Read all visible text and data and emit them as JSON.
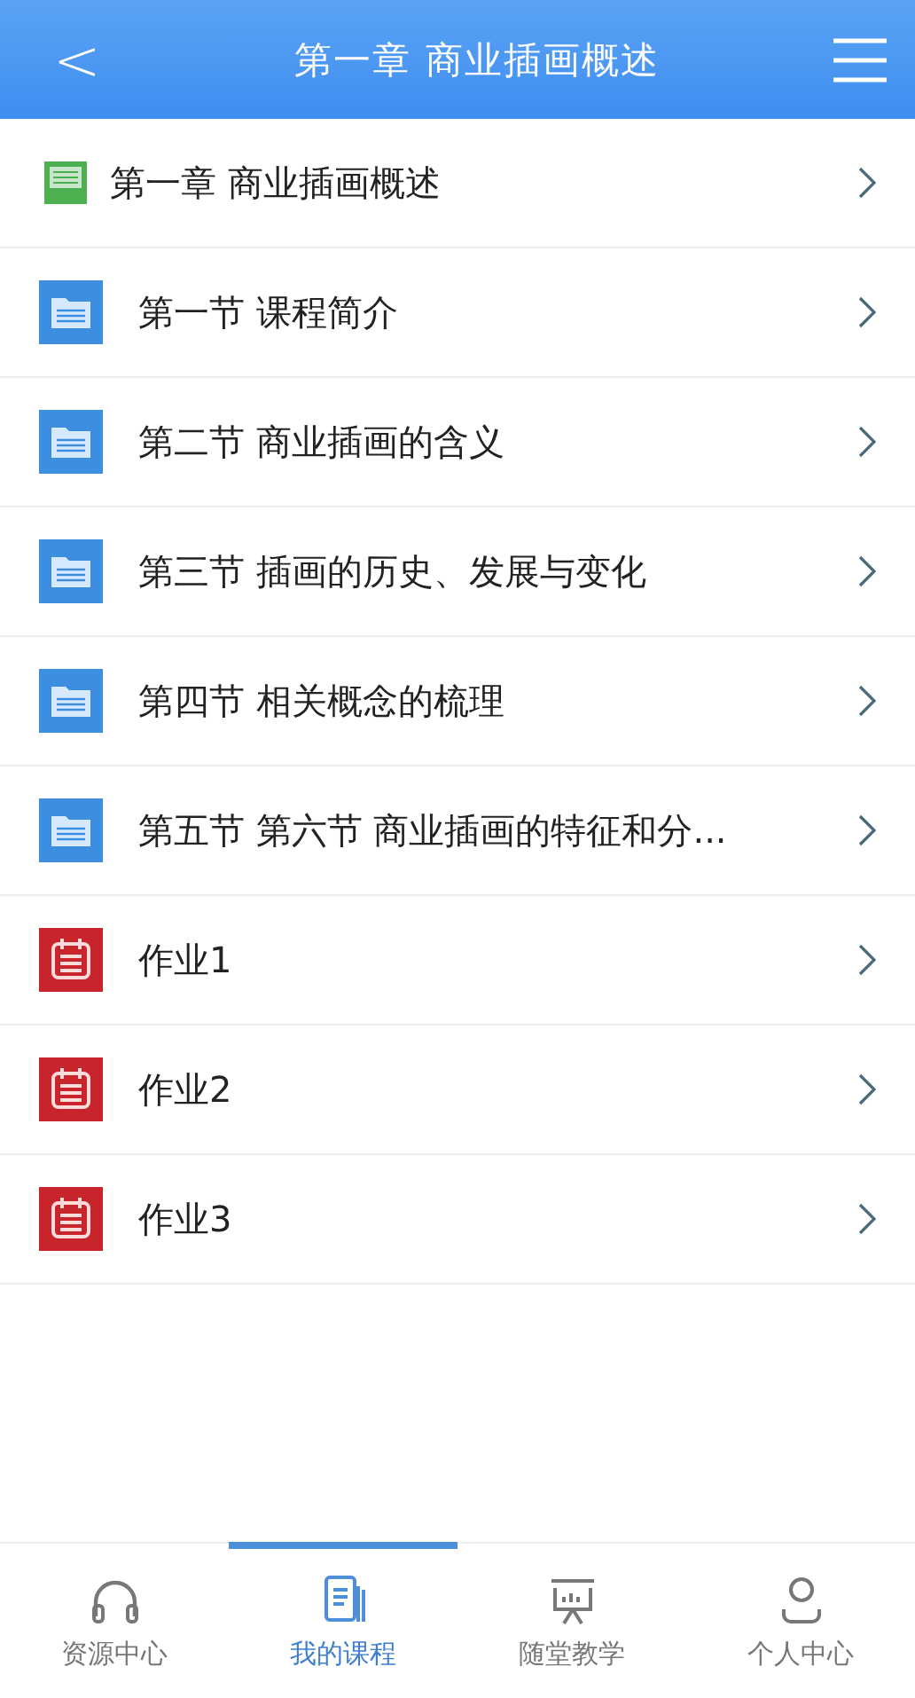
{
  "header": {
    "title": "第一章 商业插画概述",
    "back": "<"
  },
  "items": [
    {
      "kind": "chapter",
      "label": "第一章 商业插画概述"
    },
    {
      "kind": "section",
      "label": "第一节 课程简介"
    },
    {
      "kind": "section",
      "label": "第二节 商业插画的含义"
    },
    {
      "kind": "section",
      "label": "第三节 插画的历史、发展与变化"
    },
    {
      "kind": "section",
      "label": "第四节 相关概念的梳理"
    },
    {
      "kind": "section",
      "label": "第五节 第六节 商业插画的特征和分..."
    },
    {
      "kind": "homework",
      "label": "作业1"
    },
    {
      "kind": "homework",
      "label": "作业2"
    },
    {
      "kind": "homework",
      "label": "作业3"
    }
  ],
  "tabs": [
    {
      "kind": "headphones",
      "label": "资源中心",
      "selected": false
    },
    {
      "kind": "book",
      "label": "我的课程",
      "selected": true
    },
    {
      "kind": "board",
      "label": "随堂教学",
      "selected": false
    },
    {
      "kind": "person",
      "label": "个人中心",
      "selected": false
    }
  ]
}
